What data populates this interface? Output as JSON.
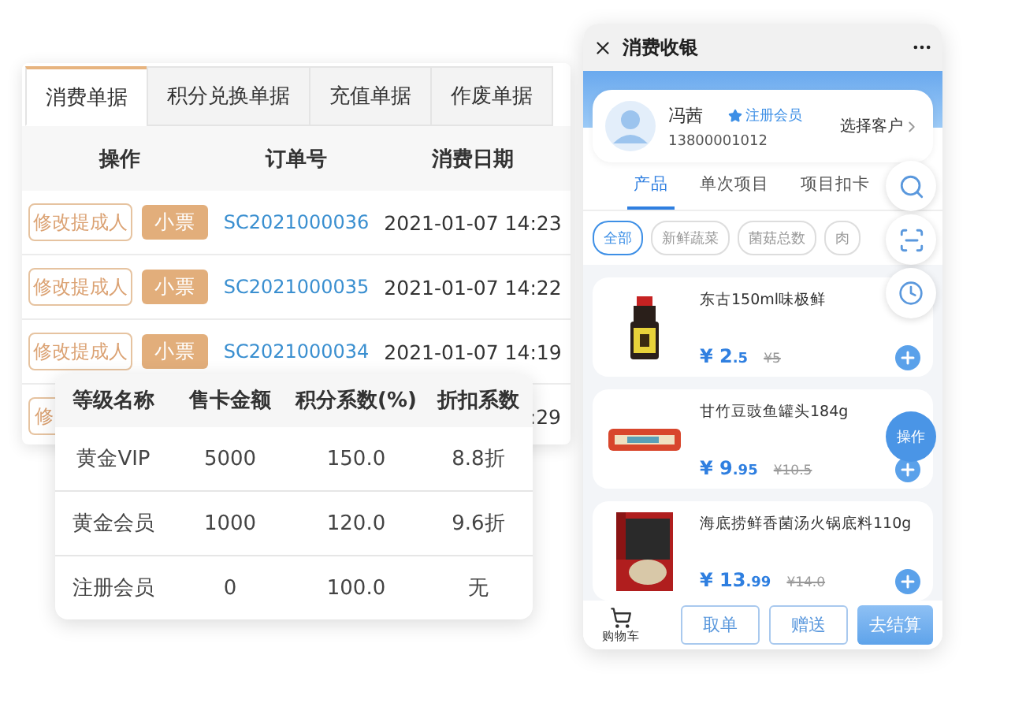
{
  "orders_panel": {
    "tabs": [
      {
        "label": "消费单据",
        "selected": true
      },
      {
        "label": "积分兑换单据",
        "selected": false
      },
      {
        "label": "充值单据",
        "selected": false
      },
      {
        "label": "作废单据",
        "selected": false
      }
    ],
    "columns": [
      "操作",
      "订单号",
      "消费日期"
    ],
    "rows": [
      {
        "edit_button": "修改提成人",
        "receipt_button": "小票",
        "order_no": "SC2021000036",
        "date": "2021-01-07 14:23"
      },
      {
        "edit_button": "修改提成人",
        "receipt_button": "小票",
        "order_no": "SC2021000035",
        "date": "2021-01-07 14:22"
      },
      {
        "edit_button": "修改提成人",
        "receipt_button": "小票",
        "order_no": "SC2021000034",
        "date": "2021-01-07 14:19"
      },
      {
        "edit_button": "修",
        "date": ":29"
      }
    ]
  },
  "levels_panel": {
    "columns": [
      "等级名称",
      "售卡金额",
      "积分系数(%)",
      "折扣系数"
    ],
    "rows": [
      [
        "黄金VIP",
        "5000",
        "150.0",
        "8.8折"
      ],
      [
        "黄金会员",
        "1000",
        "120.0",
        "9.6折"
      ],
      [
        "注册会员",
        "0",
        "100.0",
        "无"
      ]
    ]
  },
  "cashier": {
    "title": "消费收银",
    "customer": {
      "name": "冯茜",
      "badge": "注册会员",
      "phone": "13800001012",
      "select": "选择客户"
    },
    "tabs": [
      {
        "label": "产品",
        "selected": true
      },
      {
        "label": "单次项目",
        "selected": false
      },
      {
        "label": "项目扣卡",
        "selected": false
      }
    ],
    "chips": [
      {
        "label": "全部",
        "selected": true
      },
      {
        "label": "新鲜蔬菜",
        "selected": false
      },
      {
        "label": "菌菇总数",
        "selected": false
      },
      {
        "label": "肉",
        "selected": false
      }
    ],
    "products": [
      {
        "name": "东古150ml味极鲜",
        "price_main": "¥ 2",
        "price_cents": ".5",
        "old_price": "¥5",
        "kind": "bottle"
      },
      {
        "name": "甘竹豆豉鱼罐头184g",
        "price_main": "¥ 9",
        "price_cents": ".95",
        "old_price": "¥10.5",
        "kind": "can"
      },
      {
        "name": "海底捞鲜香菌汤火锅底料110g",
        "price_main": "¥ 13",
        "price_cents": ".99",
        "old_price": "¥14.0",
        "kind": "pack"
      }
    ],
    "action_button": "操作",
    "cart_label": "购物车",
    "buttons": [
      {
        "label": "取单",
        "kind": "outline"
      },
      {
        "label": "赠送",
        "kind": "outline"
      },
      {
        "label": "去结算",
        "kind": "primary"
      }
    ]
  }
}
